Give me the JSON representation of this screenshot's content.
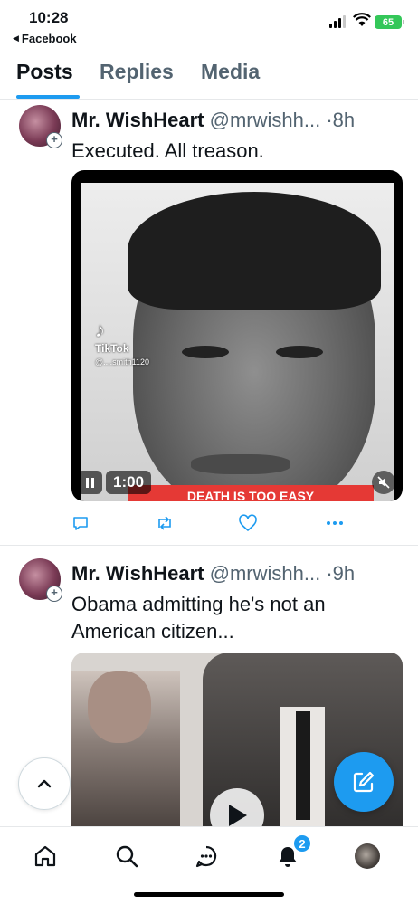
{
  "status_bar": {
    "time": "10:28",
    "back_app": "Facebook",
    "battery": "65"
  },
  "tabs": [
    {
      "label": "Posts",
      "active": true
    },
    {
      "label": "Replies",
      "active": false
    },
    {
      "label": "Media",
      "active": false
    }
  ],
  "posts": [
    {
      "author": "Mr. WishHeart",
      "handle": "@mrwishh...",
      "separator": "·",
      "ago": "8h",
      "text": "Executed. All treason.",
      "media": {
        "type": "video",
        "duration": "1:00",
        "watermark": "TikTok",
        "watermark_user": "@....smith1120",
        "banner_text": "DEATH IS TOO EASY"
      }
    },
    {
      "author": "Mr. WishHeart",
      "handle": "@mrwishh...",
      "separator": "·",
      "ago": "9h",
      "text": "Obama admitting he's not an American citizen...",
      "media": {
        "type": "video"
      }
    }
  ],
  "bottom_nav": {
    "items": [
      "home",
      "search",
      "messages",
      "notifications",
      "profile"
    ],
    "notifications_badge": "2"
  },
  "colors": {
    "accent": "#1d9bf0",
    "text": "#0f1419",
    "secondary": "#536471"
  }
}
